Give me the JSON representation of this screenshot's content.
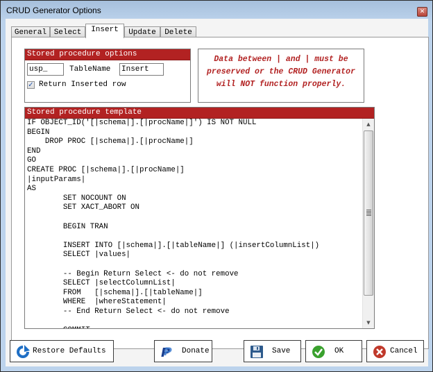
{
  "window": {
    "title": "CRUD Generator Options",
    "close_glyph": "✕"
  },
  "tabs": [
    {
      "label": "General",
      "active": false
    },
    {
      "label": "Select",
      "active": false
    },
    {
      "label": "Insert",
      "active": true
    },
    {
      "label": "Update",
      "active": false
    },
    {
      "label": "Delete",
      "active": false
    }
  ],
  "options": {
    "header": "Stored procedure options",
    "prefix_value": "usp_",
    "tablename_label": "TableName",
    "suffix_value": "Insert",
    "return_row_label": "Return Inserted row",
    "return_row_checked": true,
    "check_glyph": "✓"
  },
  "warning": {
    "text": "Data between | and | must be preserved or the CRUD Generator will NOT function properly.",
    "color": "#b22222"
  },
  "template": {
    "header": "Stored procedure template",
    "code": "IF OBJECT_ID('[|schema|].[|procName|]') IS NOT NULL\nBEGIN\n    DROP PROC [|schema|].[|procName|]\nEND\nGO\nCREATE PROC [|schema|].[|procName|]\n|inputParams|\nAS\n\tSET NOCOUNT ON\n\tSET XACT_ABORT ON\n\n\tBEGIN TRAN\n\n\tINSERT INTO [|schema|].[|tableName|] (|insertColumnList|)\n\tSELECT |values|\n\n\t-- Begin Return Select <- do not remove\n\tSELECT |selectColumnList|\n\tFROM   [|schema|].[|tableName|]\n\tWHERE  |whereStatement|\n\t-- End Return Select <- do not remove\n\n\tCOMMIT",
    "scroll_up_glyph": "▲",
    "scroll_down_glyph": "▼"
  },
  "buttons": {
    "restore": "Restore Defaults",
    "donate": "Donate",
    "save": "Save",
    "ok": "OK",
    "cancel": "Cancel"
  },
  "colors": {
    "accent_red": "#b22222",
    "ok_green": "#3aa12e",
    "cancel_red": "#c0392b",
    "restore_blue": "#1f6fc5",
    "paypal_blue": "#1a3f8f"
  }
}
